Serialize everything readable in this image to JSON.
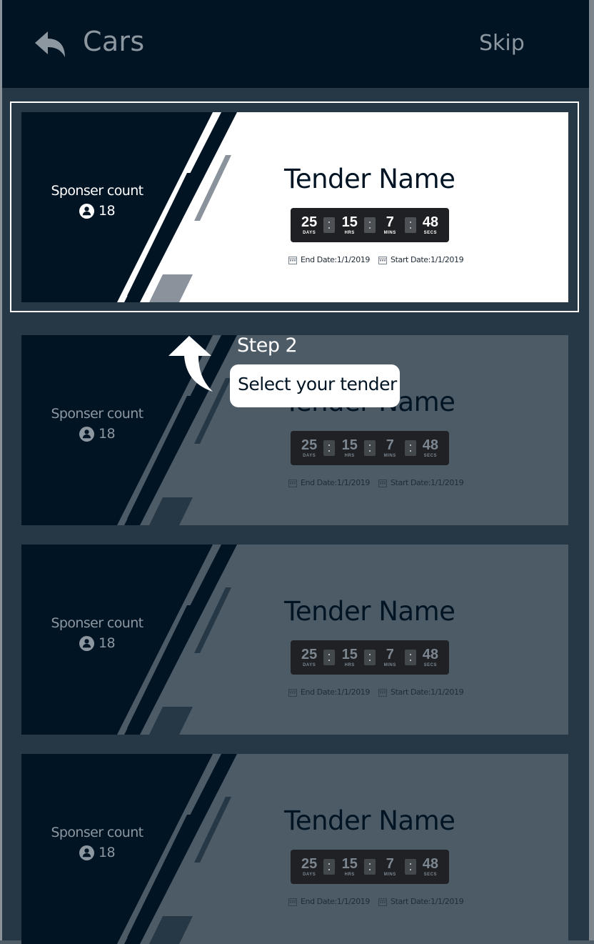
{
  "header": {
    "title": "Cars",
    "skip_label": "Skip",
    "back_icon": "reply-arrow-icon"
  },
  "colors": {
    "header_bg": "#011424",
    "list_bg": "#263846",
    "overlay_card": "#4d5b66",
    "active_card": "#ffffff",
    "accent_dark": "#011424"
  },
  "tenders": [
    {
      "sponsor_label": "Sponser count",
      "sponsor_count": "18",
      "name": "Tender Name",
      "timer": {
        "days": "25",
        "days_label": "DAYS",
        "hrs": "15",
        "hrs_label": "HRS",
        "mins": "7",
        "mins_label": "MINS",
        "secs": "48",
        "secs_label": "SECS"
      },
      "end_date": "End Date:1/1/2019",
      "start_date": "Start Date:1/1/2019"
    },
    {
      "sponsor_label": "Sponser count",
      "sponsor_count": "18",
      "name": "Tender Name",
      "timer": {
        "days": "25",
        "days_label": "DAYS",
        "hrs": "15",
        "hrs_label": "HRS",
        "mins": "7",
        "mins_label": "MINS",
        "secs": "48",
        "secs_label": "SECS"
      },
      "end_date": "End Date:1/1/2019",
      "start_date": "Start Date:1/1/2019"
    },
    {
      "sponsor_label": "Sponser count",
      "sponsor_count": "18",
      "name": "Tender Name",
      "timer": {
        "days": "25",
        "days_label": "DAYS",
        "hrs": "15",
        "hrs_label": "HRS",
        "mins": "7",
        "mins_label": "MINS",
        "secs": "48",
        "secs_label": "SECS"
      },
      "end_date": "End Date:1/1/2019",
      "start_date": "Start Date:1/1/2019"
    },
    {
      "sponsor_label": "Sponser count",
      "sponsor_count": "18",
      "name": "Tender Name",
      "timer": {
        "days": "25",
        "days_label": "DAYS",
        "hrs": "15",
        "hrs_label": "HRS",
        "mins": "7",
        "mins_label": "MINS",
        "secs": "48",
        "secs_label": "SECS"
      },
      "end_date": "End Date:1/1/2019",
      "start_date": "Start Date:1/1/2019"
    }
  ],
  "coachmark": {
    "step": "Step 2",
    "message": "Select your tender",
    "arrow_icon": "curved-arrow-up-icon"
  }
}
